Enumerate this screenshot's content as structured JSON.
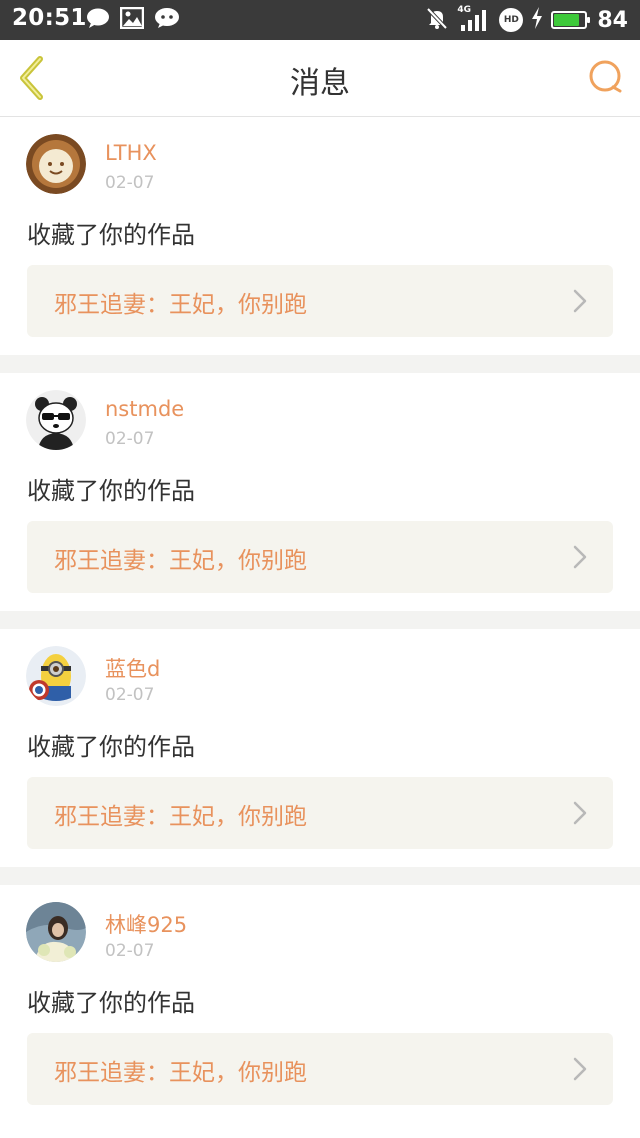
{
  "status_bar": {
    "time": "20:51",
    "battery_level": "84",
    "battery_fraction": 0.84,
    "left_icons": [
      "chat-bubble-icon",
      "image-icon",
      "message-icon"
    ],
    "right_icons": [
      "mute-icon",
      "signal-4g-icon",
      "hd-icon",
      "charging-icon",
      "battery-icon"
    ],
    "network_label": "4G",
    "hd_label": "HD"
  },
  "header": {
    "title": "消息",
    "back_icon": "chevron-left-icon",
    "search_icon": "search-icon"
  },
  "colors": {
    "accent": "#e8925d",
    "back_icon": "#c9c43a",
    "search_icon": "#f0a25d",
    "card_box": "#f5f4ee",
    "separator": "#f3f3f1",
    "battery_fill": "#3ec93a"
  },
  "messages": [
    {
      "username": "LTHX",
      "date": "02-07",
      "action": "收藏了你的作品",
      "work_title": "邪王追妻：王妃，你别跑",
      "avatar": "latte-art-avatar"
    },
    {
      "username": "nstmde",
      "date": "02-07",
      "action": "收藏了你的作品",
      "work_title": "邪王追妻：王妃，你别跑",
      "avatar": "panda-avatar"
    },
    {
      "username": "蓝色d",
      "date": "02-07",
      "action": "收藏了你的作品",
      "work_title": "邪王追妻：王妃，你别跑",
      "avatar": "minion-avatar"
    },
    {
      "username": "林峰925",
      "date": "02-07",
      "action": "收藏了你的作品",
      "work_title": "邪王追妻：王妃，你别跑",
      "avatar": "photo-avatar"
    }
  ]
}
